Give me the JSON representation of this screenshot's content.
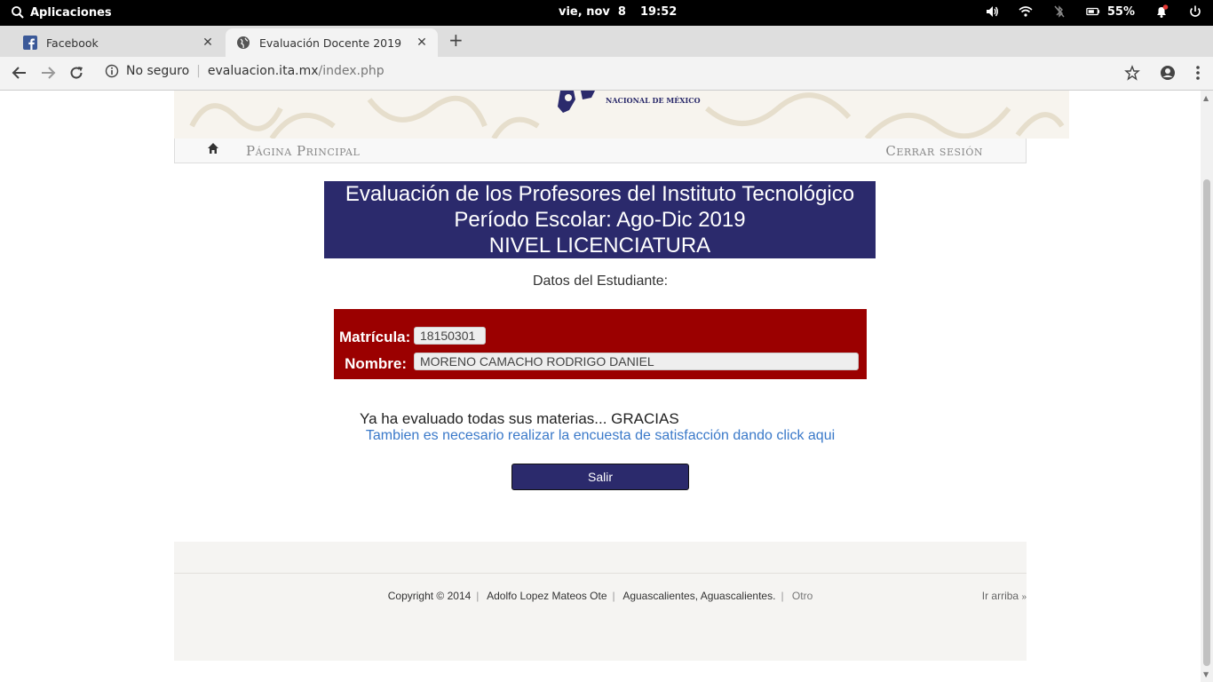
{
  "system_bar": {
    "apps_label": "Aplicaciones",
    "date": "vie, nov  8",
    "time": "19:52",
    "battery": "55%"
  },
  "browser": {
    "tabs": [
      {
        "label": "Facebook",
        "icon": "facebook-icon",
        "active": false
      },
      {
        "label": "Evaluación Docente 2019",
        "icon": "globe-icon",
        "active": true
      }
    ],
    "security_label": "No seguro",
    "url_host": "evaluacion.ita.mx",
    "url_path": "/index.php"
  },
  "header": {
    "logo_text": "NACIONAL DE MÉXICO",
    "nav_home": "Página Principal",
    "nav_logout": "Cerrar sesión"
  },
  "title": {
    "line1": "Evaluación de los Profesores del Instituto Tecnológico",
    "line2": "Período Escolar: Ago-Dic 2019",
    "line3": "NIVEL LICENCIATURA"
  },
  "student": {
    "section_label": "Datos del Estudiante:",
    "matricula_label": "Matrícula:",
    "matricula_value": "18150301",
    "nombre_label": "Nombre:",
    "nombre_value": "MORENO CAMACHO RODRIGO DANIEL"
  },
  "messages": {
    "done": "Ya ha evaluado todas sus materias... GRACIAS",
    "survey_link": "Tambien es necesario realizar la encuesta de satisfacción dando click aqui",
    "exit_button": "Salir"
  },
  "footer": {
    "copyright": "Copyright © 2014",
    "address": "Adolfo Lopez Mateos Ote",
    "city": "Aguascalientes, Aguascalientes.",
    "other": "Otro",
    "back_to_top": "Ir arriba"
  },
  "colors": {
    "title_bg": "#2b2a6c",
    "student_box_bg": "#9b0000",
    "link": "#3a79c9"
  }
}
